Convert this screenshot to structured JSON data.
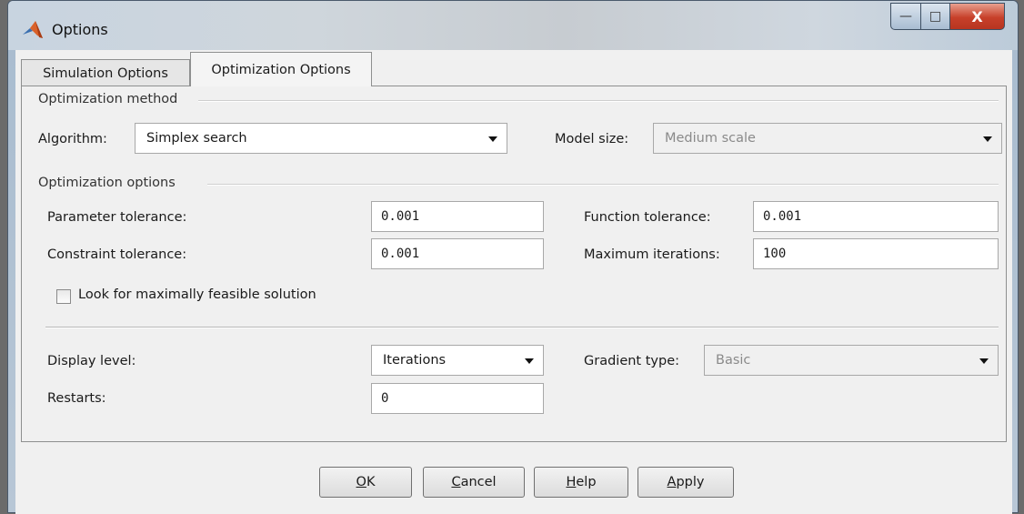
{
  "window": {
    "title": "Options",
    "controls": {
      "minimize": "—",
      "maximize": "□",
      "close": "X"
    }
  },
  "tabs": [
    {
      "label": "Simulation Options",
      "selected": false
    },
    {
      "label": "Optimization Options",
      "selected": true
    }
  ],
  "optimization_method": {
    "heading": "Optimization method",
    "algorithm_label": "Algorithm:",
    "algorithm_value": "Simplex search",
    "model_size_label": "Model size:",
    "model_size_value": "Medium scale"
  },
  "optimization_options": {
    "heading": "Optimization options",
    "parameter_tolerance_label": "Parameter tolerance:",
    "parameter_tolerance_value": "0.001",
    "function_tolerance_label": "Function tolerance:",
    "function_tolerance_value": "0.001",
    "constraint_tolerance_label": "Constraint tolerance:",
    "constraint_tolerance_value": "0.001",
    "maximum_iterations_label": "Maximum iterations:",
    "maximum_iterations_value": "100",
    "feasible_checkbox_label": "Look for maximally feasible solution",
    "feasible_checked": false,
    "display_level_label": "Display level:",
    "display_level_value": "Iterations",
    "gradient_type_label": "Gradient type:",
    "gradient_type_value": "Basic",
    "restarts_label": "Restarts:",
    "restarts_value": "0"
  },
  "buttons": {
    "ok_mnemonic": "O",
    "ok_rest": "K",
    "cancel_mnemonic": "C",
    "cancel_rest": "ancel",
    "help_mnemonic": "H",
    "help_rest": "elp",
    "apply_mnemonic": "A",
    "apply_rest": "pply"
  },
  "colors": {
    "close_button": "#c7402a",
    "dialog_bg": "#f0f0f0"
  }
}
